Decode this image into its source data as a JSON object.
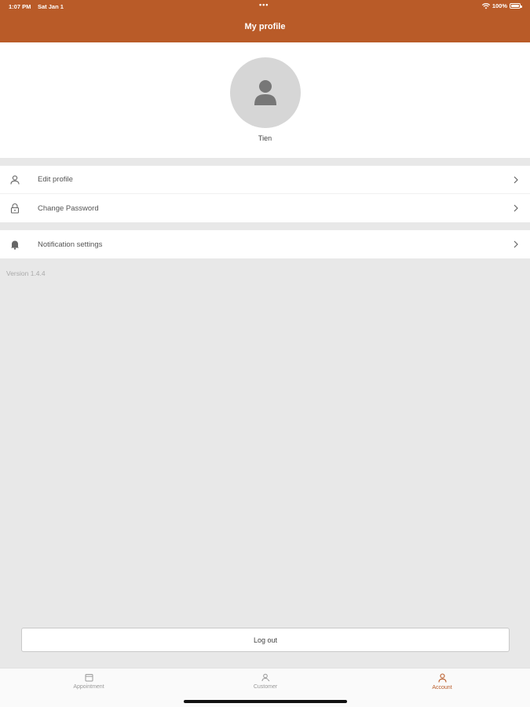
{
  "status_bar": {
    "time": "1:07 PM",
    "date": "Sat Jan 1",
    "battery": "100%"
  },
  "header": {
    "title": "My profile"
  },
  "profile": {
    "name": "Tien",
    "avatar_icon": "user-icon"
  },
  "menu": {
    "group1": [
      {
        "label": "Edit profile",
        "icon": "user-icon"
      },
      {
        "label": "Change Password",
        "icon": "lock-icon"
      }
    ],
    "group2": [
      {
        "label": "Notification settings",
        "icon": "bell-icon"
      }
    ]
  },
  "version": "Version 1.4.4",
  "logout_label": "Log out",
  "tabs": [
    {
      "label": "Appointment",
      "icon": "calendar-icon",
      "active": false
    },
    {
      "label": "Customer",
      "icon": "customer-icon",
      "active": false
    },
    {
      "label": "Account",
      "icon": "user-icon",
      "active": true
    }
  ],
  "colors": {
    "accent": "#b95b28",
    "background": "#e8e8e8"
  }
}
